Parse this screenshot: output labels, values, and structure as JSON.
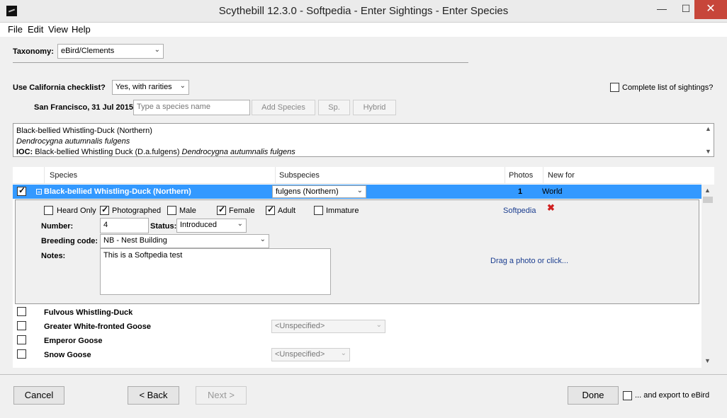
{
  "window": {
    "title": "Scythebill 12.3.0 - Softpedia - Enter Sightings - Enter Species"
  },
  "window_controls": {
    "minimize": "—",
    "maximize": "☐",
    "close": "✕"
  },
  "menu": [
    "File",
    "Edit",
    "View",
    "Help"
  ],
  "taxonomy": {
    "label": "Taxonomy:",
    "value": "eBird/Clements"
  },
  "checklist": {
    "label": "Use California checklist?",
    "value": "Yes, with rarities"
  },
  "complete_list": {
    "label": "Complete list of sightings?",
    "checked": false
  },
  "location_date": "San Francisco, 31 Jul 2015",
  "species_input": {
    "placeholder": "Type a species name",
    "value": ""
  },
  "buttons": {
    "add_species": "Add Species",
    "sp": "Sp.",
    "hybrid": "Hybrid",
    "cancel": "Cancel",
    "back": "< Back",
    "next": "Next >",
    "done": "Done"
  },
  "info": {
    "line1": "Black-bellied Whistling-Duck (Northern)",
    "line2": "Dendrocygna autumnalis fulgens",
    "line3_prefix": "IOC:",
    "line3_text": "Black-bellied Whistling Duck (D.a.fulgens)",
    "line3_latin": "Dendrocygna autumnalis fulgens"
  },
  "columns": {
    "species": "Species",
    "subspecies": "Subspecies",
    "photos": "Photos",
    "new_for": "New for"
  },
  "selected_row": {
    "name": "Black-bellied Whistling-Duck (Northern)",
    "subspecies": "fulgens  (Northern)",
    "photos": "1",
    "new_for": "World",
    "checked": true
  },
  "detail": {
    "heard_only": {
      "label": "Heard Only",
      "checked": false
    },
    "photographed": {
      "label": "Photographed",
      "checked": true
    },
    "male": {
      "label": "Male",
      "checked": false
    },
    "female": {
      "label": "Female",
      "checked": true
    },
    "adult": {
      "label": "Adult",
      "checked": true
    },
    "immature": {
      "label": "Immature",
      "checked": false
    },
    "photo_credit": "Softpedia",
    "number_label": "Number:",
    "number_value": "4",
    "status_label": "Status:",
    "status_value": "Introduced",
    "breeding_label": "Breeding code:",
    "breeding_value": "NB - Nest Building",
    "notes_label": "Notes:",
    "notes_value": "This is a Softpedia test",
    "photo_drop": "Drag a photo or click..."
  },
  "rows": [
    {
      "name": "Fulvous Whistling-Duck",
      "subspecies": ""
    },
    {
      "name": "Greater White-fronted Goose",
      "subspecies": "<Unspecified>"
    },
    {
      "name": "Emperor Goose",
      "subspecies": ""
    },
    {
      "name": "Snow Goose",
      "subspecies": "<Unspecified>"
    }
  ],
  "export": {
    "label": "... and export to eBird",
    "checked": false
  },
  "icons": [
    "app-icon",
    "dropdown-arrow-icon",
    "checkmark-icon",
    "collapse-icon",
    "delete-icon",
    "scroll-up-icon",
    "scroll-down-icon"
  ]
}
